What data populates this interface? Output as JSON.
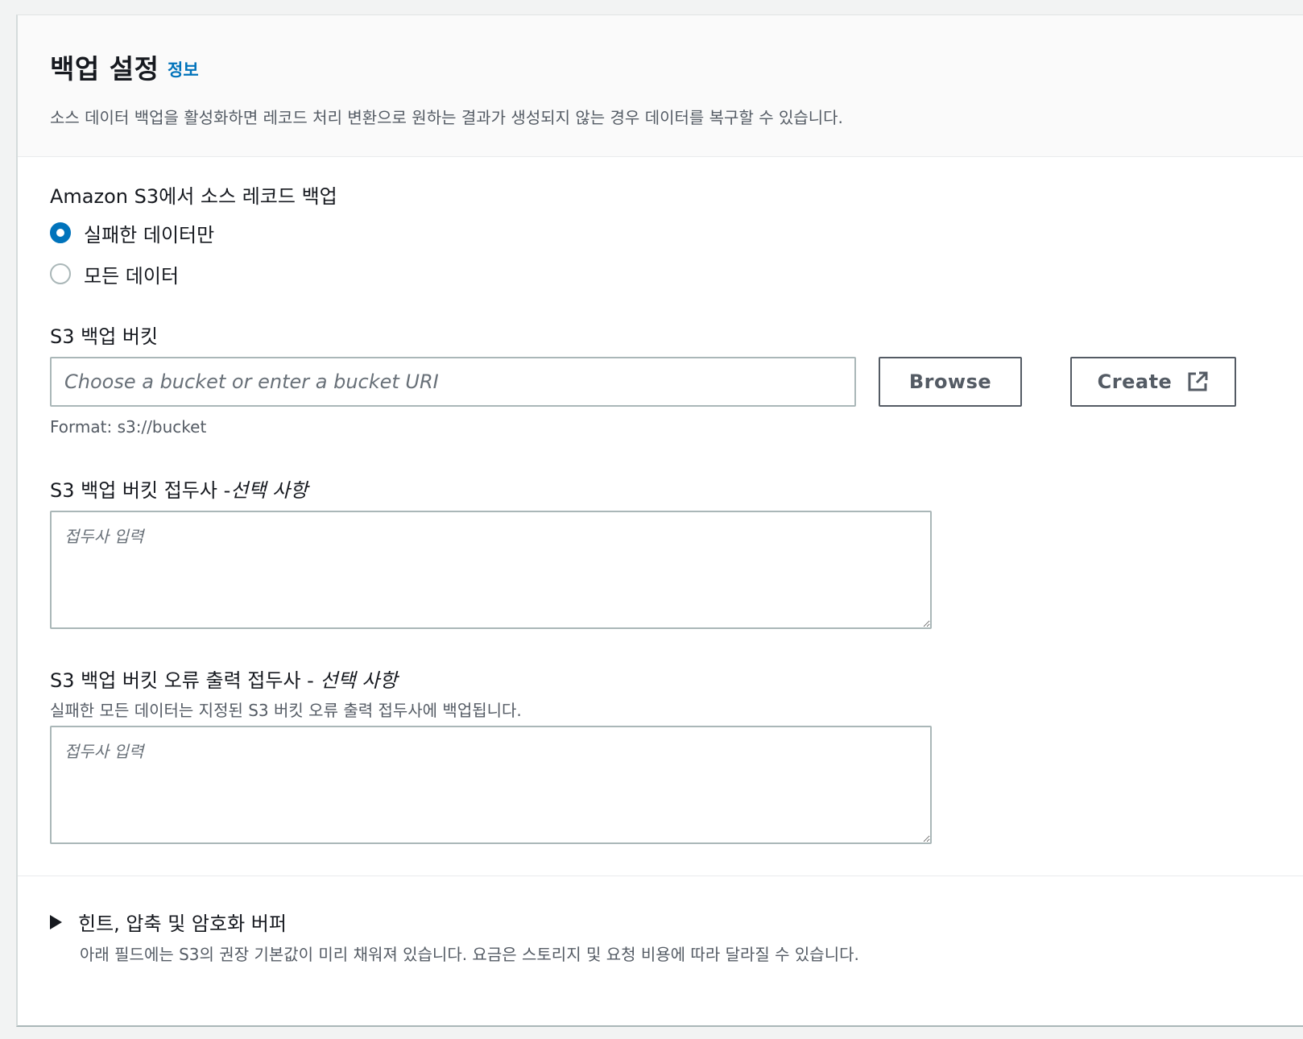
{
  "header": {
    "title": "백업 설정",
    "info_link": "정보",
    "description": "소스 데이터 백업을 활성화하면 레코드 처리 변환으로 원하는 결과가 생성되지 않는 경우 데이터를 복구할 수 있습니다."
  },
  "backup_mode": {
    "label": "Amazon S3에서 소스 레코드 백업",
    "options": [
      {
        "label": "실패한 데이터만",
        "selected": true
      },
      {
        "label": "모든 데이터",
        "selected": false
      }
    ]
  },
  "bucket": {
    "label": "S3 백업 버킷",
    "value": "",
    "placeholder": "Choose a bucket or enter a bucket URI",
    "browse_label": "Browse",
    "create_label": "Create",
    "format_hint": "Format: s3://bucket"
  },
  "prefix": {
    "label": "S3 백업 버킷 접두사 -",
    "optional": "선택 사항",
    "value": "",
    "placeholder": "접두사 입력"
  },
  "error_prefix": {
    "label": "S3 백업 버킷 오류 출력 접두사 - ",
    "optional": "선택 사항",
    "description": "실패한 모든 데이터는 지정된 S3 버킷 오류 출력 접두사에 백업됩니다.",
    "value": "",
    "placeholder": "접두사 입력"
  },
  "advanced": {
    "title": "힌트, 압축 및 암호화 버퍼",
    "description": "아래 필드에는 S3의 권장 기본값이 미리 채워져 있습니다. 요금은 스토리지 및 요청 비용에 따라 달라질 수 있습니다."
  },
  "colors": {
    "accent": "#0073bb",
    "text": "#16191f",
    "secondary_text": "#545b64",
    "border": "#aab7b8"
  }
}
